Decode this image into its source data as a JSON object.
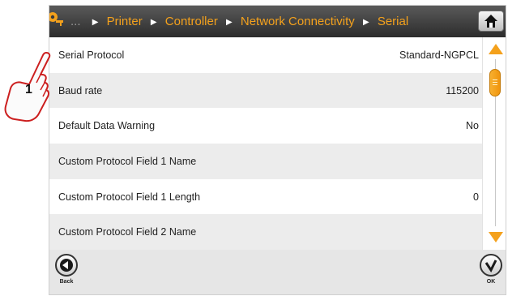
{
  "breadcrumb": {
    "ellipsis": "...",
    "items": [
      "Printer",
      "Controller",
      "Network Connectivity",
      "Serial"
    ]
  },
  "rows": [
    {
      "label": "Serial Protocol",
      "value": "Standard-NGPCL"
    },
    {
      "label": "Baud rate",
      "value": "115200"
    },
    {
      "label": "Default Data Warning",
      "value": "No"
    },
    {
      "label": "Custom Protocol Field 1 Name",
      "value": ""
    },
    {
      "label": "Custom Protocol Field 1 Length",
      "value": "0"
    },
    {
      "label": "Custom Protocol Field 2 Name",
      "value": ""
    }
  ],
  "footer": {
    "back_label": "Back",
    "ok_label": "OK"
  },
  "callout": {
    "number": "1"
  },
  "colors": {
    "accent": "#f4a11c",
    "header": "#3a3a3a",
    "row_alt": "#ececec"
  },
  "icons": [
    "key-icon",
    "home-icon",
    "scroll-up-icon",
    "scroll-down-icon",
    "back-arrow-icon",
    "ok-check-icon",
    "pointing-hand-icon"
  ]
}
